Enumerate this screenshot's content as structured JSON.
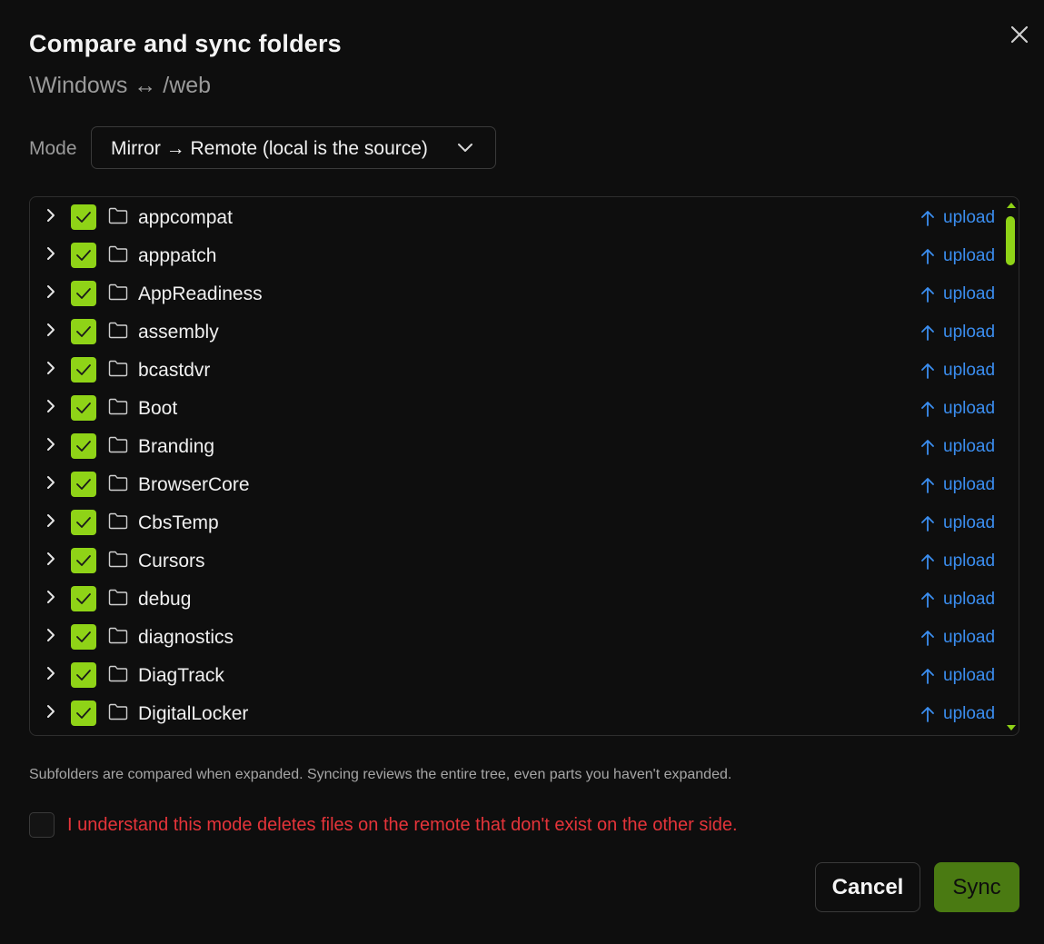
{
  "dialog": {
    "title": "Compare and sync folders",
    "subtitle": "\\Windows ↔ /web",
    "close_icon": "close-icon"
  },
  "mode": {
    "label": "Mode",
    "selected": "Mirror → Remote (local is the source)",
    "icon": "chevron-down-icon"
  },
  "tree": {
    "items": [
      {
        "name": "appcompat",
        "checked": true,
        "action": "upload"
      },
      {
        "name": "apppatch",
        "checked": true,
        "action": "upload"
      },
      {
        "name": "AppReadiness",
        "checked": true,
        "action": "upload"
      },
      {
        "name": "assembly",
        "checked": true,
        "action": "upload"
      },
      {
        "name": "bcastdvr",
        "checked": true,
        "action": "upload"
      },
      {
        "name": "Boot",
        "checked": true,
        "action": "upload"
      },
      {
        "name": "Branding",
        "checked": true,
        "action": "upload"
      },
      {
        "name": "BrowserCore",
        "checked": true,
        "action": "upload"
      },
      {
        "name": "CbsTemp",
        "checked": true,
        "action": "upload"
      },
      {
        "name": "Cursors",
        "checked": true,
        "action": "upload"
      },
      {
        "name": "debug",
        "checked": true,
        "action": "upload"
      },
      {
        "name": "diagnostics",
        "checked": true,
        "action": "upload"
      },
      {
        "name": "DiagTrack",
        "checked": true,
        "action": "upload"
      },
      {
        "name": "DigitalLocker",
        "checked": true,
        "action": "upload"
      }
    ]
  },
  "note": "Subfolders are compared when expanded. Syncing reviews the entire tree, even parts you haven't expanded.",
  "confirm": {
    "checked": false,
    "label": "I understand this mode deletes files on the remote that don't exist on the other side."
  },
  "buttons": {
    "cancel": "Cancel",
    "sync": "Sync"
  },
  "colors": {
    "accent": "#8fd317",
    "sync_button": "#4a7a12",
    "upload": "#3b8ef0",
    "warning": "#e5343a",
    "background": "#0e0e0e"
  }
}
